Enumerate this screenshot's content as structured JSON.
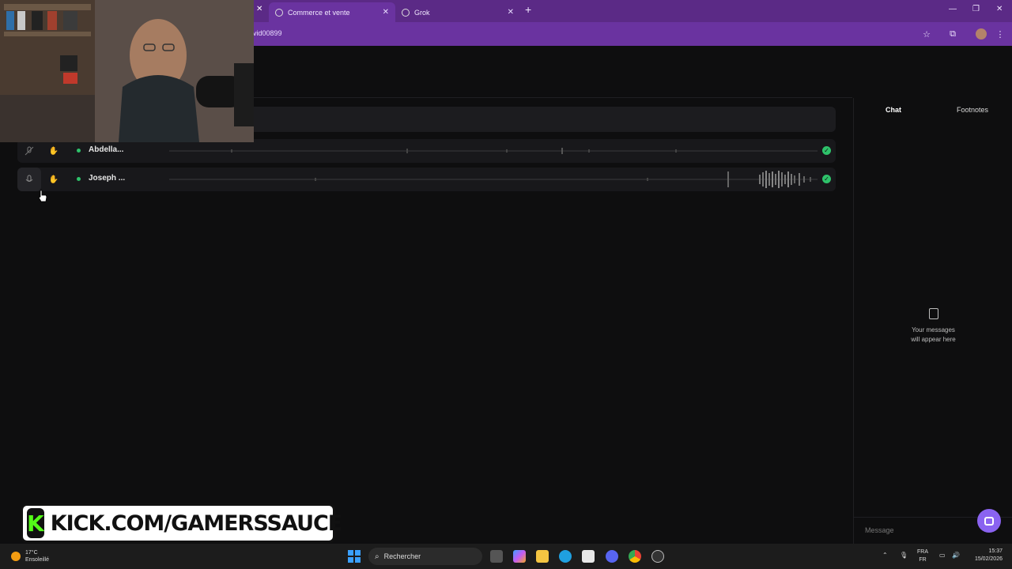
{
  "browser": {
    "tabs": [
      {
        "label": "Commerce et vente",
        "active": true
      },
      {
        "label": "Grok",
        "active": false
      }
    ],
    "url": "vid00899"
  },
  "participants": [
    {
      "name": "Abdella...",
      "muted": true,
      "status": "connected"
    },
    {
      "name": "Joseph ...",
      "muted": false,
      "status": "connected"
    }
  ],
  "sidebar": {
    "tabs": [
      {
        "label": "Chat",
        "active": true
      },
      {
        "label": "Footnotes",
        "active": false
      }
    ],
    "empty_line1": "Your messages",
    "empty_line2": "will appear here",
    "message_placeholder": "Message"
  },
  "overlay": {
    "kick_letter": "K",
    "kick_text": "KICK.COM/GAMERSSAUCE"
  },
  "taskbar": {
    "temperature": "17°C",
    "weather": "Ensoleillé",
    "search_label": "Rechercher",
    "lang_top": "FRA",
    "lang_bottom": "FR",
    "time": "15:37",
    "date": "15/02/2026"
  },
  "colors": {
    "browser_accent": "#6a33a0",
    "status_green": "#2ec26a",
    "kick_green": "#53fc18",
    "help_purple": "#8a63f0"
  }
}
